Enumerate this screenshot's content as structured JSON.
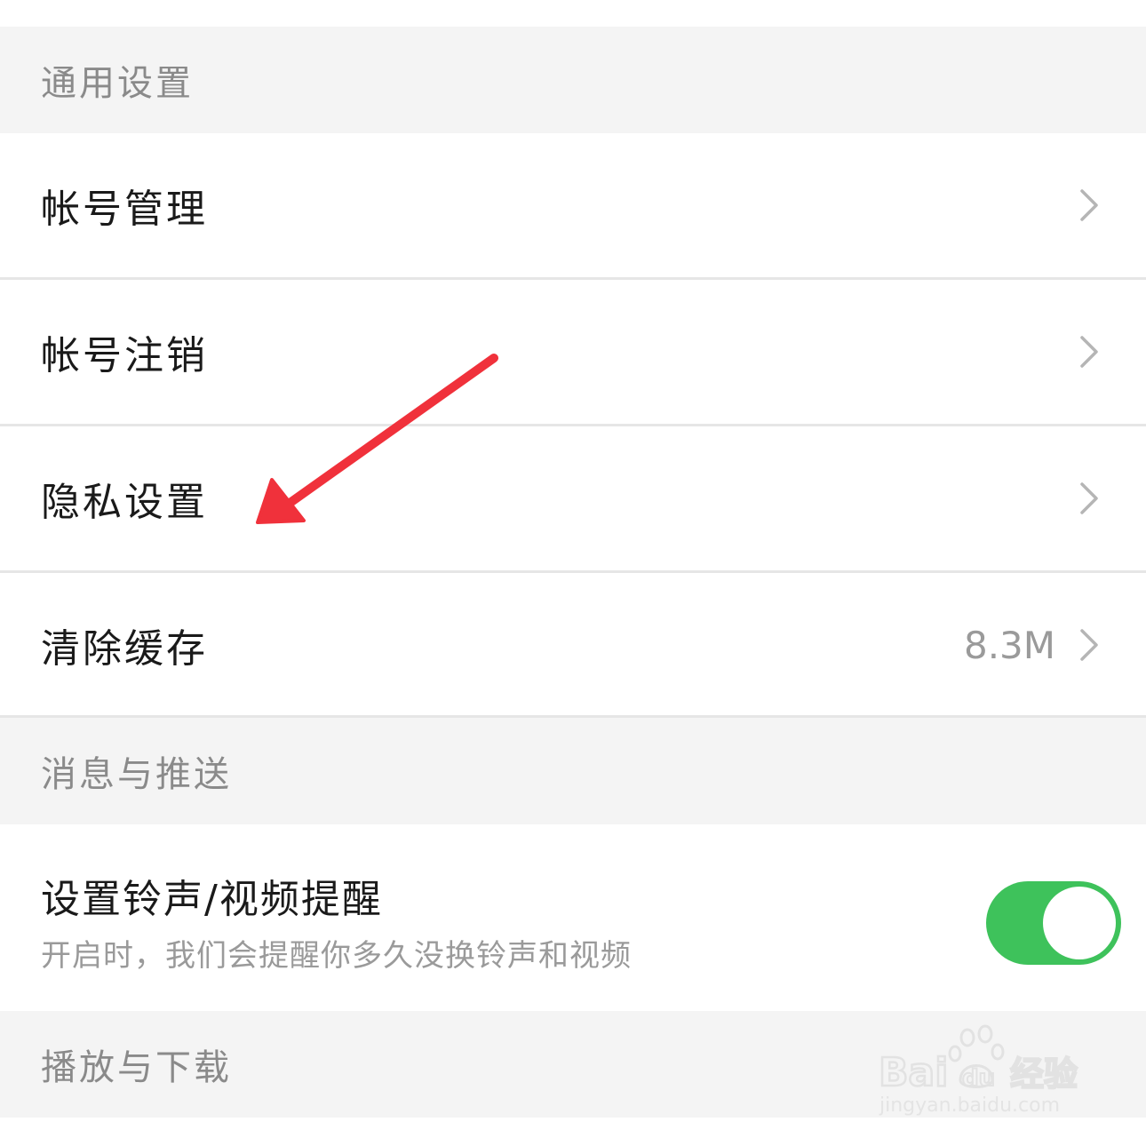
{
  "sections": {
    "general": {
      "title": "通用设置"
    },
    "messages": {
      "title": "消息与推送"
    },
    "playback": {
      "title": "播放与下载"
    }
  },
  "rows": {
    "account_management": {
      "label": "帐号管理"
    },
    "account_cancel": {
      "label": "帐号注销"
    },
    "privacy": {
      "label": "隐私设置"
    },
    "clear_cache": {
      "label": "清除缓存",
      "value": "8.3M"
    }
  },
  "ringtone_toggle": {
    "title": "设置铃声/视频提醒",
    "subtitle": "开启时，我们会提醒你多久没换铃声和视频",
    "enabled": true,
    "on_color": "#3ec25b"
  },
  "annotation": {
    "arrow_color": "#f0313b"
  },
  "watermark": {
    "brand": "Baidu经验",
    "url": "jingyan.baidu.com"
  },
  "icons": {
    "row_chevron": "chevron-right-icon"
  }
}
